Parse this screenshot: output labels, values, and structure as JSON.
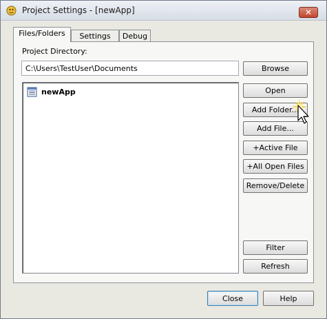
{
  "window": {
    "title": "Project Settings - [newApp]",
    "close_label": "✕"
  },
  "tabs": [
    {
      "label": "Files/Folders",
      "active": true
    },
    {
      "label": "Settings",
      "active": false
    },
    {
      "label": "Debug",
      "active": false
    }
  ],
  "files": {
    "project_directory_label": "Project Directory:",
    "project_directory_value": "C:\\Users\\TestUser\\Documents",
    "browse_label": "Browse",
    "tree_items": [
      {
        "label": "newApp"
      }
    ],
    "buttons": {
      "open": "Open",
      "add_folder": "Add Folder...",
      "add_file": "Add File...",
      "active_file": "+Active File",
      "all_open_files": "+All Open Files",
      "remove_delete": "Remove/Delete",
      "filter": "Filter",
      "refresh": "Refresh"
    }
  },
  "footer": {
    "close_label": "Close",
    "help_label": "Help"
  },
  "colors": {
    "window_bg": "#e9e9e2",
    "default_button_border": "#3c7fb1",
    "close_button": "#c4462c"
  }
}
